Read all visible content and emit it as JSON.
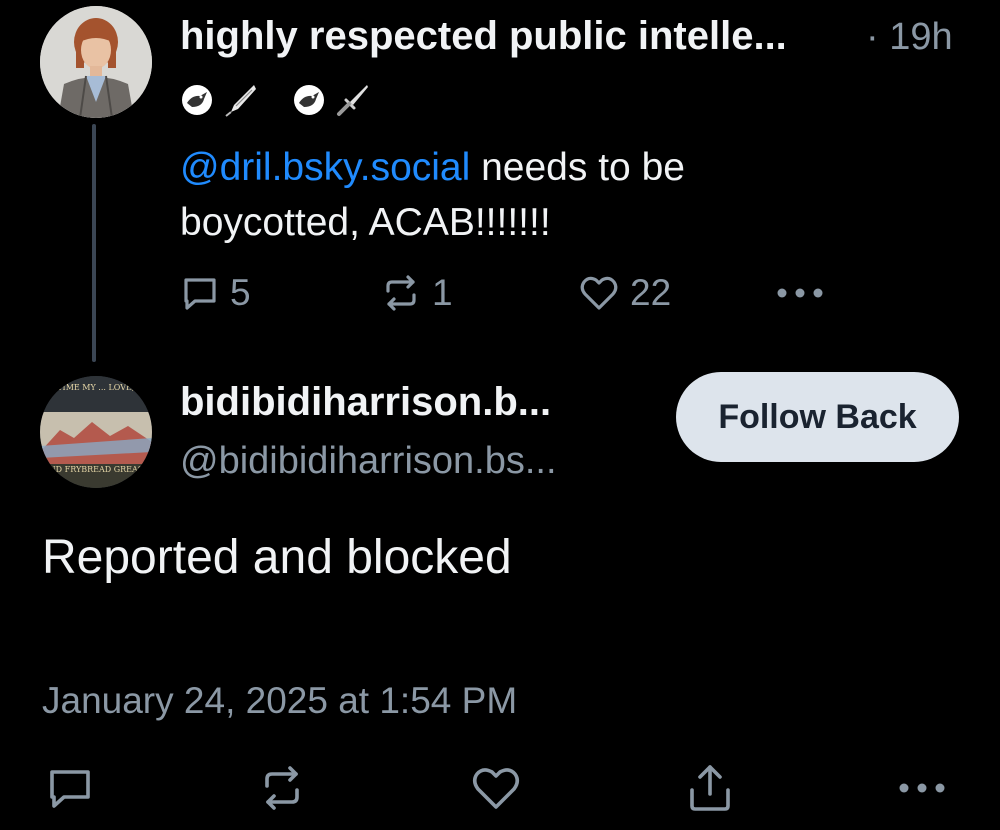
{
  "parent_post": {
    "author_display_name": "highly respected public intelle...",
    "time_ago": "· 19h",
    "badge_icons": [
      "pigeon-icon",
      "fountain-pen-icon",
      "pigeon-icon",
      "dagger-icon"
    ],
    "mention": "@dril.bsky.social",
    "text_line1_rest": " needs to be",
    "text_line2": "boycotted, ACAB!!!!!!!",
    "reply_count": "5",
    "repost_count": "1",
    "like_count": "22"
  },
  "main_post": {
    "author_display_name": "bidibidiharrison.b...",
    "author_handle": "@bidibidiharrison.bs...",
    "follow_button_label": "Follow Back",
    "text": "Reported and blocked",
    "timestamp": "January 24, 2025 at 1:54 PM",
    "avatar_caption_top": "EVERY TIME MY ... LOVE, PEACE",
    "avatar_caption_bottom": "AND FRYBREAD GREASE"
  },
  "icons": {
    "reply": "speech-bubble-icon",
    "repost": "repost-arrows-icon",
    "like": "heart-icon",
    "share": "share-upload-icon",
    "more": "ellipsis-icon"
  },
  "colors": {
    "background": "#000000",
    "text_primary": "#f1f3f5",
    "text_secondary": "#8b98a5",
    "link": "#208bfe",
    "follow_button_bg": "#dde4ec",
    "thread_line": "#3b4654"
  }
}
